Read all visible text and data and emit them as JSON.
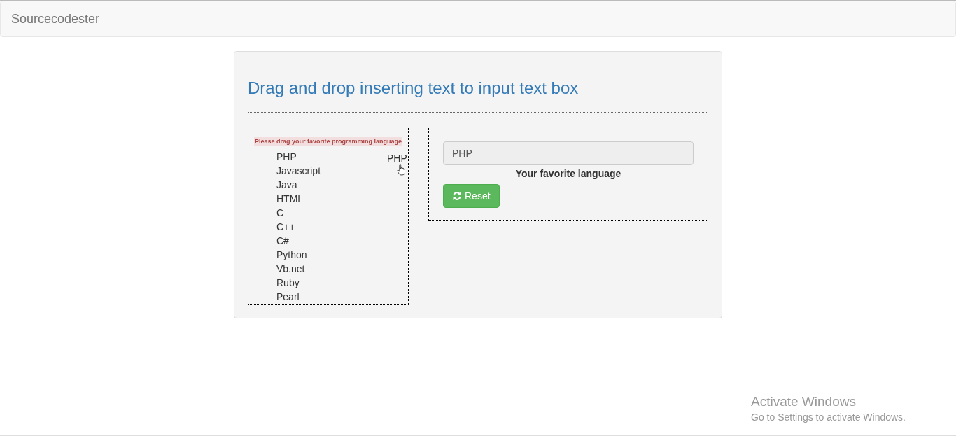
{
  "navbar": {
    "brand": "Sourcecodester"
  },
  "panel": {
    "title": "Drag and drop inserting text to input text box"
  },
  "source_list": {
    "hint": "Please drag your favorite programming language",
    "items": [
      "PHP",
      "Javascript",
      "Java",
      "HTML",
      "C",
      "C++",
      "C#",
      "Python",
      "Vb.net",
      "Ruby",
      "Pearl"
    ],
    "drag_ghost": "PHP"
  },
  "target": {
    "value": "PHP",
    "caption": "Your favorite language",
    "button": "Reset"
  },
  "os_notice": {
    "title": "Activate Windows",
    "subtitle": "Go to Settings to activate Windows."
  }
}
